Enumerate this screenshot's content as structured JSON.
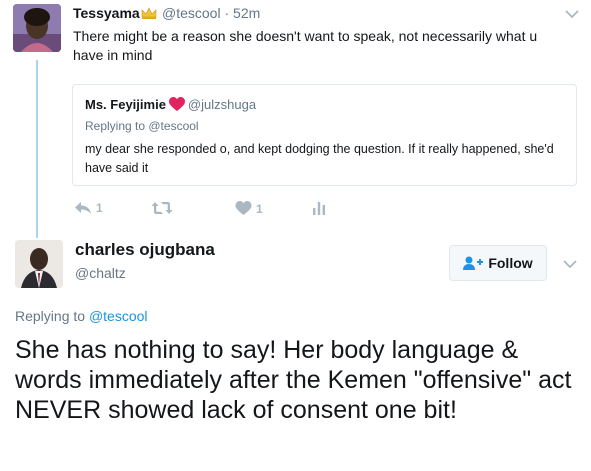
{
  "tweet_1": {
    "display_name": "Tessyama",
    "name_icon": "crown-emoji",
    "handle": "@tescool",
    "separator": "·",
    "time": "52m",
    "text": "There might be a reason she doesn't want to speak, not necessarily what u have in mind",
    "quoted": {
      "display_name": "Ms. Feyijimie",
      "name_icon": "red-heart",
      "handle": "@julzshuga",
      "reply_prefix": "Replying to ",
      "reply_to": "@tescool",
      "text": "my dear she responded o, and kept dodging the question. If it really happened, she'd have said it"
    },
    "actions": {
      "reply_count": "1",
      "retweet_count": "",
      "like_count": "1"
    }
  },
  "tweet_2": {
    "display_name": "charles ojugbana",
    "handle": "@chaltz",
    "follow_label": "Follow",
    "reply_prefix": "Replying to ",
    "reply_to": "@tescool",
    "text": "She has nothing to say! Her body language & words immediately after the Kemen \"offensive\" act NEVER showed lack of consent one bit!"
  },
  "colors": {
    "text": "#14171a",
    "secondary": "#657786",
    "link": "#1b95e0",
    "thread_line": "#a8d4ef",
    "action_icons": "#aab8c2",
    "heart": "#e0245e"
  }
}
